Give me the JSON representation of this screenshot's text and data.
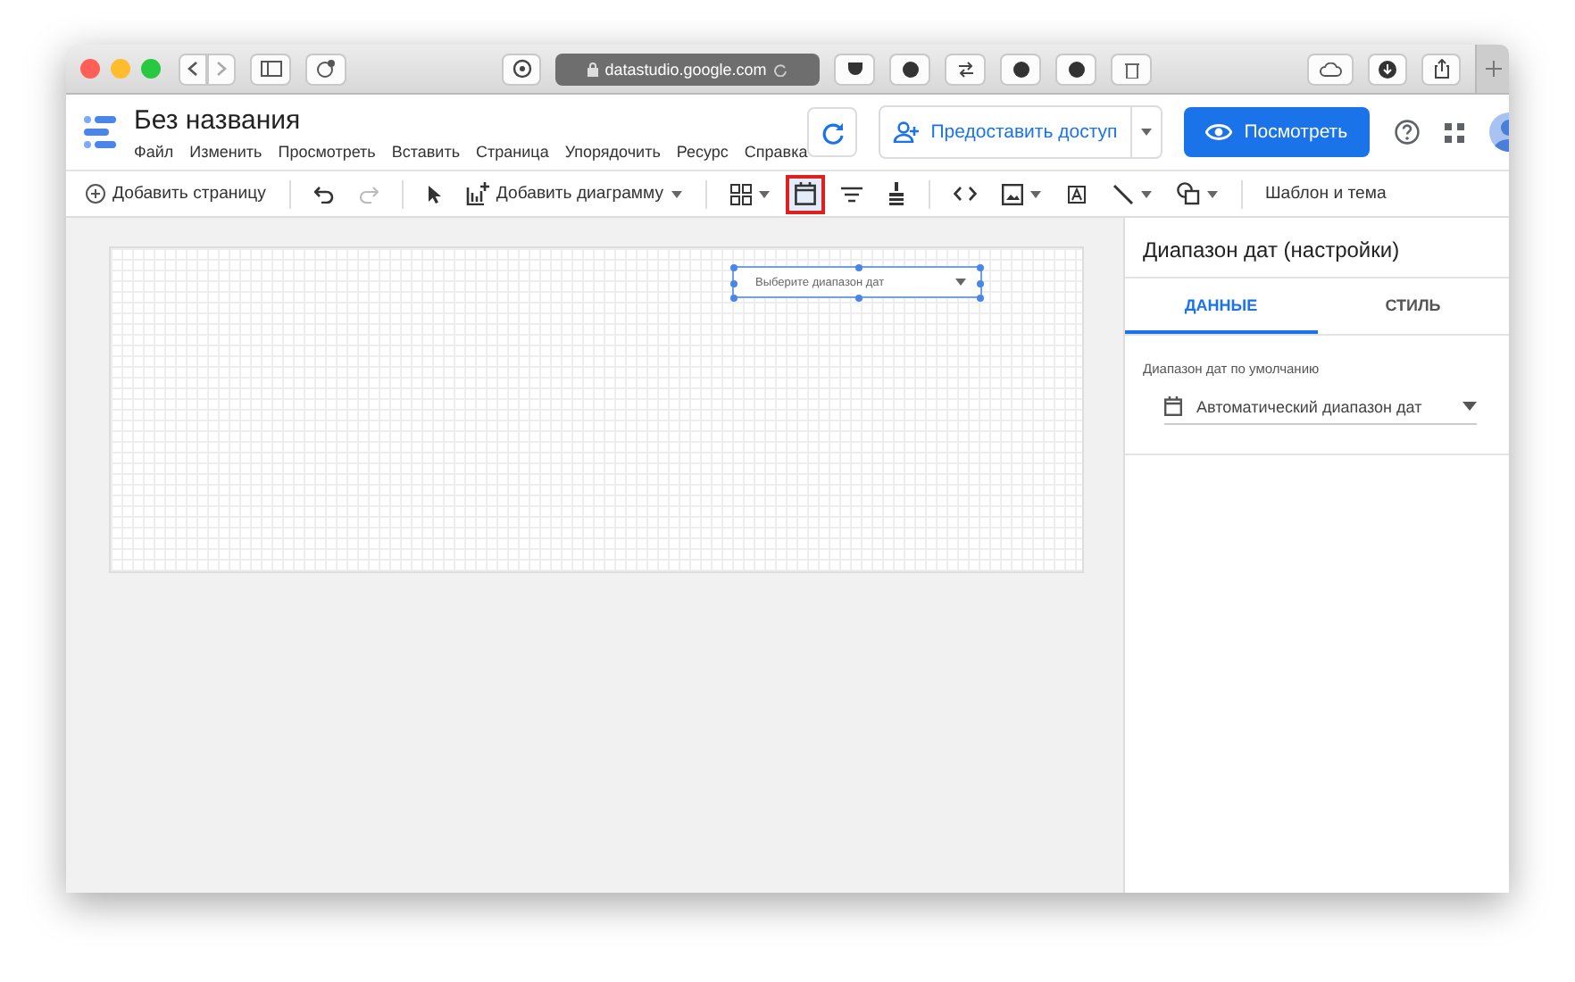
{
  "browser": {
    "url": "datastudio.google.com"
  },
  "app": {
    "title": "Без названия",
    "menu": [
      "Файл",
      "Изменить",
      "Просмотреть",
      "Вставить",
      "Страница",
      "Упорядочить",
      "Ресурс",
      "Справка"
    ],
    "share_button": "Предоставить доступ",
    "view_button": "Посмотреть"
  },
  "toolbar": [
    {
      "kind": "add-page",
      "label": "Добавить страницу",
      "highlighted": false
    },
    {
      "kind": "separator"
    },
    {
      "kind": "undo",
      "highlighted": false,
      "disabled": false
    },
    {
      "kind": "redo",
      "highlighted": false,
      "disabled": true
    },
    {
      "kind": "separator"
    },
    {
      "kind": "pointer",
      "highlighted": false
    },
    {
      "kind": "add-chart",
      "label": "Добавить диаграмму",
      "highlighted": false
    },
    {
      "kind": "separator"
    },
    {
      "kind": "controls",
      "highlighted": false
    },
    {
      "kind": "date-range",
      "highlighted": true
    },
    {
      "kind": "filter",
      "highlighted": false
    },
    {
      "kind": "data-control",
      "highlighted": false
    },
    {
      "kind": "separator"
    },
    {
      "kind": "code",
      "highlighted": false
    },
    {
      "kind": "image",
      "highlighted": false
    },
    {
      "kind": "text-box",
      "highlighted": false
    },
    {
      "kind": "line",
      "highlighted": false
    },
    {
      "kind": "shape",
      "highlighted": false
    },
    {
      "kind": "separator"
    },
    {
      "kind": "theme",
      "label": "Шаблон и тема",
      "highlighted": false
    }
  ],
  "canvas": {
    "date_control": {
      "placeholder": "Выберите диапазон дат",
      "selected": true
    }
  },
  "panel": {
    "title": "Диапазон дат (настройки)",
    "tabs": [
      {
        "label": "ДАННЫЕ",
        "selected": true
      },
      {
        "label": "СТИЛЬ",
        "selected": false
      }
    ],
    "field_label": "Диапазон дат по умолчанию",
    "field_value": "Автоматический диапазон дат"
  }
}
